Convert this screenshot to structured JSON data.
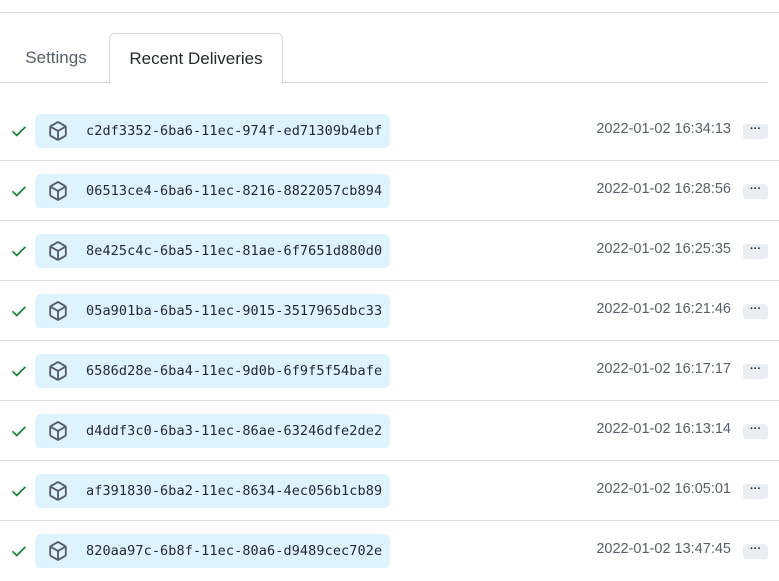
{
  "tabs": {
    "settings_label": "Settings",
    "recent_deliveries_label": "Recent Deliveries"
  },
  "deliveries": [
    {
      "guid": "c2df3352-6ba6-11ec-974f-ed71309b4ebf",
      "timestamp": "2022-01-02 16:34:13",
      "status": "success",
      "more": "···"
    },
    {
      "guid": "06513ce4-6ba6-11ec-8216-8822057cb894",
      "timestamp": "2022-01-02 16:28:56",
      "status": "success",
      "more": "···"
    },
    {
      "guid": "8e425c4c-6ba5-11ec-81ae-6f7651d880d0",
      "timestamp": "2022-01-02 16:25:35",
      "status": "success",
      "more": "···"
    },
    {
      "guid": "05a901ba-6ba5-11ec-9015-3517965dbc33",
      "timestamp": "2022-01-02 16:21:46",
      "status": "success",
      "more": "···"
    },
    {
      "guid": "6586d28e-6ba4-11ec-9d0b-6f9f5f54bafe",
      "timestamp": "2022-01-02 16:17:17",
      "status": "success",
      "more": "···"
    },
    {
      "guid": "d4ddf3c0-6ba3-11ec-86ae-63246dfe2de2",
      "timestamp": "2022-01-02 16:13:14",
      "status": "success",
      "more": "···"
    },
    {
      "guid": "af391830-6ba2-11ec-8634-4ec056b1cb89",
      "timestamp": "2022-01-02 16:05:01",
      "status": "success",
      "more": "···"
    },
    {
      "guid": "820aa97c-6b8f-11ec-80a6-d9489cec702e",
      "timestamp": "2022-01-02 13:47:45",
      "status": "success",
      "more": "···"
    }
  ],
  "colors": {
    "success": "#1a7f37",
    "pill_bg": "#ddf4ff",
    "icon": "#57606a"
  },
  "icons": {
    "status": "check-icon",
    "delivery": "package-icon",
    "more": "kebab-horizontal-icon"
  }
}
